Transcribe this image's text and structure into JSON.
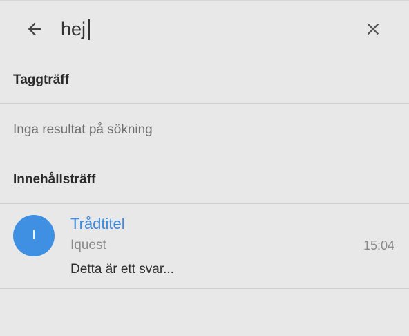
{
  "search": {
    "query": "hej",
    "back_icon": "arrow-left-icon",
    "clear_icon": "close-icon"
  },
  "tag_section": {
    "header": "Taggträff",
    "empty_message": "Inga resultat på sökning"
  },
  "content_section": {
    "header": "Innehållsträff",
    "results": [
      {
        "avatar_initial": "I",
        "title": "Trådtitel",
        "author": "Iquest",
        "time": "15:04",
        "snippet": "Detta är ett svar..."
      }
    ]
  },
  "colors": {
    "background": "#e8e8e8",
    "accent": "#3d8ae0",
    "avatar": "#3f8fe3"
  }
}
